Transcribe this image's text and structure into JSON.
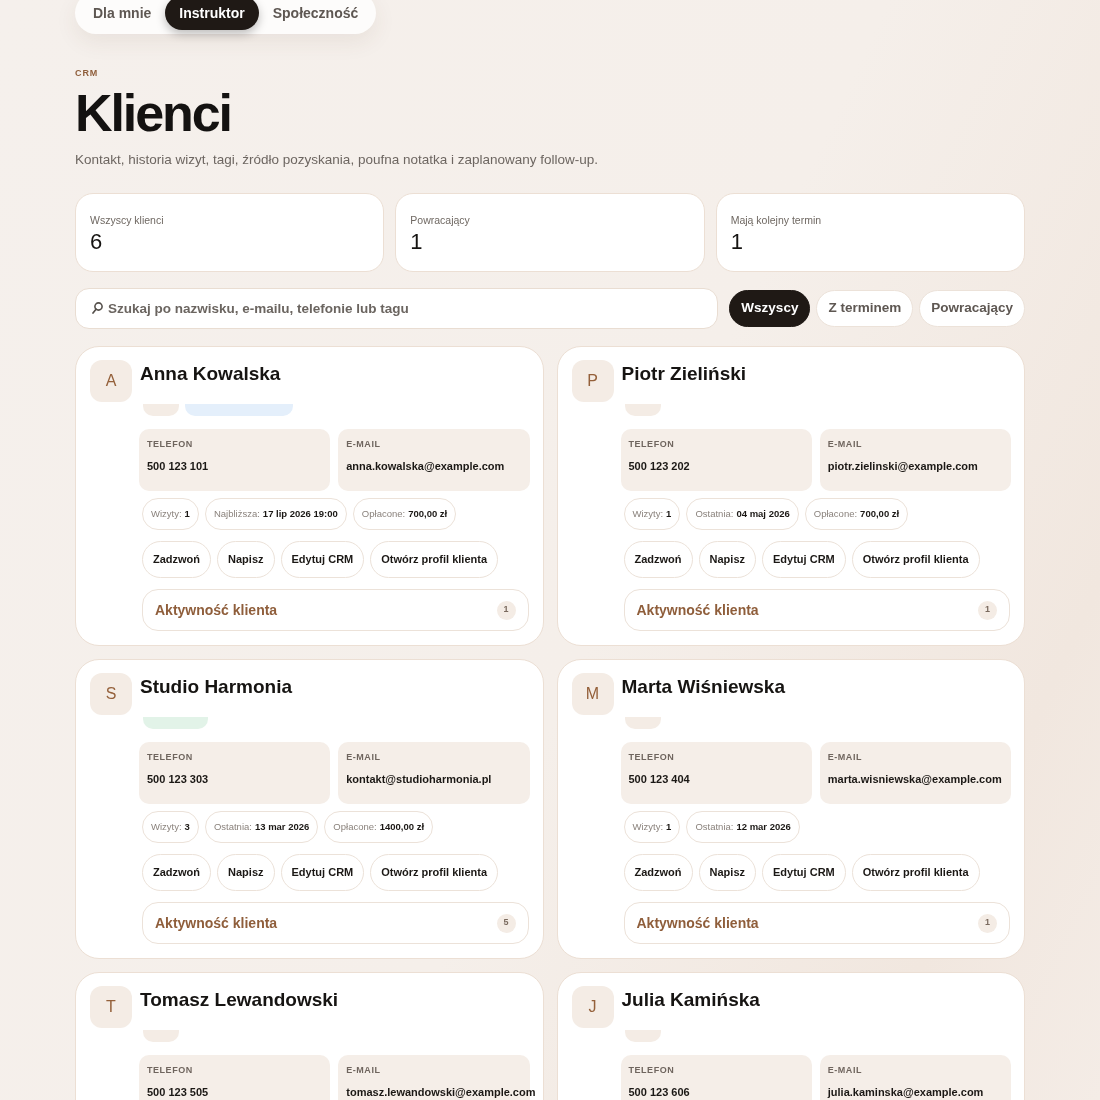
{
  "nav": {
    "tabs": [
      {
        "label": "Dla mnie",
        "selected": false
      },
      {
        "label": "Instruktor",
        "selected": true
      },
      {
        "label": "Społeczność",
        "selected": false
      }
    ]
  },
  "header": {
    "eyebrow": "CRM",
    "title": "Klienci",
    "subtitle": "Kontakt, historia wizyt, tagi, źródło pozyskania, poufna notatka i zaplanowany follow-up."
  },
  "stats": [
    {
      "label": "Wszyscy klienci",
      "value": "6"
    },
    {
      "label": "Powracający",
      "value": "1"
    },
    {
      "label": "Mają kolejny termin",
      "value": "1"
    }
  ],
  "search": {
    "placeholder": "Szukaj po nazwisku, e-mailu, telefonie lub tagu"
  },
  "filters": [
    {
      "label": "Wszyscy",
      "selected": true
    },
    {
      "label": "Z terminem",
      "selected": false
    },
    {
      "label": "Powracający",
      "selected": false
    }
  ],
  "clients": [
    {
      "initial": "A",
      "name": "Anna Kowalska",
      "tags": [
        {
          "color": "#f4ece5"
        },
        {
          "color": "#e4effb"
        }
      ],
      "contacts": [
        {
          "label": "TELEFON",
          "value": "500 123 101"
        },
        {
          "label": "E-MAIL",
          "value": "anna.kowalska@example.com"
        }
      ],
      "metrics": [
        {
          "label": "Wizyty:",
          "value": "1"
        },
        {
          "label": "Najbliższa:",
          "value": "17 lip 2026 19:00"
        },
        {
          "label": "Opłacone:",
          "value": "700,00 zł"
        }
      ],
      "actions": [
        "Zadzwoń",
        "Napisz",
        "Edytuj CRM",
        "Otwórz profil klienta"
      ],
      "activity": {
        "label": "Aktywność klienta",
        "count": "1"
      }
    },
    {
      "initial": "P",
      "name": "Piotr Zieliński",
      "tags": [
        {
          "color": "#f4ece5"
        }
      ],
      "contacts": [
        {
          "label": "TELEFON",
          "value": "500 123 202"
        },
        {
          "label": "E-MAIL",
          "value": "piotr.zielinski@example.com"
        }
      ],
      "metrics": [
        {
          "label": "Wizyty:",
          "value": "1"
        },
        {
          "label": "Ostatnia:",
          "value": "04 maj 2026"
        },
        {
          "label": "Opłacone:",
          "value": "700,00 zł"
        }
      ],
      "actions": [
        "Zadzwoń",
        "Napisz",
        "Edytuj CRM",
        "Otwórz profil klienta"
      ],
      "activity": {
        "label": "Aktywność klienta",
        "count": "1"
      }
    },
    {
      "initial": "S",
      "name": "Studio Harmonia",
      "tags": [
        {
          "color": "#e2f3e8"
        }
      ],
      "contacts": [
        {
          "label": "TELEFON",
          "value": "500 123 303"
        },
        {
          "label": "E-MAIL",
          "value": "kontakt@studioharmonia.pl"
        }
      ],
      "metrics": [
        {
          "label": "Wizyty:",
          "value": "3"
        },
        {
          "label": "Ostatnia:",
          "value": "13 mar 2026"
        },
        {
          "label": "Opłacone:",
          "value": "1400,00 zł"
        }
      ],
      "actions": [
        "Zadzwoń",
        "Napisz",
        "Edytuj CRM",
        "Otwórz profil klienta"
      ],
      "activity": {
        "label": "Aktywność klienta",
        "count": "5"
      }
    },
    {
      "initial": "M",
      "name": "Marta Wiśniewska",
      "tags": [
        {
          "color": "#f4ece5"
        }
      ],
      "contacts": [
        {
          "label": "TELEFON",
          "value": "500 123 404"
        },
        {
          "label": "E-MAIL",
          "value": "marta.wisniewska@example.com"
        }
      ],
      "metrics": [
        {
          "label": "Wizyty:",
          "value": "1"
        },
        {
          "label": "Ostatnia:",
          "value": "12 mar 2026"
        }
      ],
      "actions": [
        "Zadzwoń",
        "Napisz",
        "Edytuj CRM",
        "Otwórz profil klienta"
      ],
      "activity": {
        "label": "Aktywność klienta",
        "count": "1"
      }
    },
    {
      "initial": "T",
      "name": "Tomasz Lewandowski",
      "tags": [
        {
          "color": "#f4ece5"
        }
      ],
      "contacts": [
        {
          "label": "TELEFON",
          "value": "500 123 505"
        },
        {
          "label": "E-MAIL",
          "value": "tomasz.lewandowski@example.com"
        }
      ]
    },
    {
      "initial": "J",
      "name": "Julia Kamińska",
      "tags": [
        {
          "color": "#f4ece5"
        }
      ],
      "contacts": [
        {
          "label": "TELEFON",
          "value": "500 123 606"
        },
        {
          "label": "E-MAIL",
          "value": "julia.kaminska@example.com"
        }
      ]
    }
  ]
}
